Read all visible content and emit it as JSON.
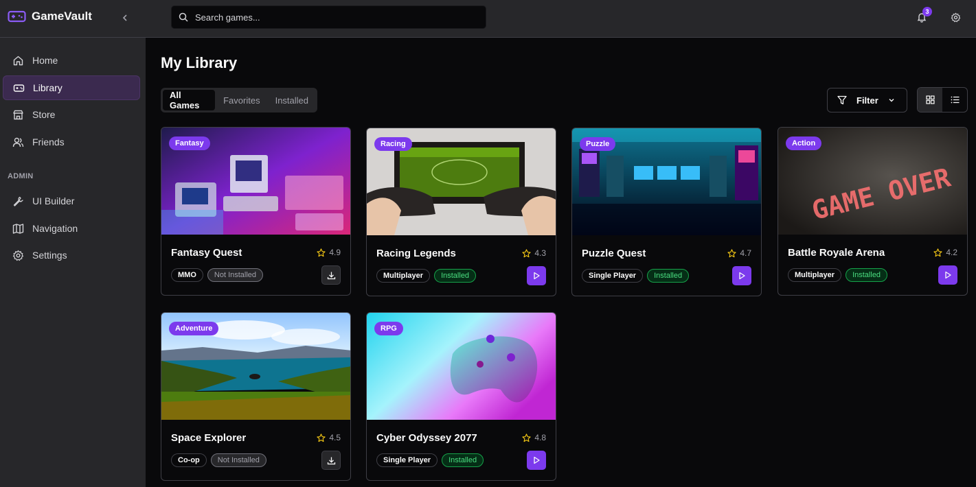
{
  "app": {
    "name": "GameVault",
    "accent": "#7c3aed"
  },
  "search": {
    "placeholder": "Search games..."
  },
  "notifications": {
    "count": "3"
  },
  "sidebar": {
    "items": [
      {
        "label": "Home",
        "icon": "home-icon"
      },
      {
        "label": "Library",
        "icon": "gamepad-icon",
        "active": true
      },
      {
        "label": "Store",
        "icon": "store-icon"
      },
      {
        "label": "Friends",
        "icon": "users-icon"
      }
    ],
    "admin_label": "ADMIN",
    "admin_items": [
      {
        "label": "UI Builder",
        "icon": "wrench-icon"
      },
      {
        "label": "Navigation",
        "icon": "map-icon"
      },
      {
        "label": "Settings",
        "icon": "settings-icon"
      }
    ]
  },
  "main": {
    "title": "My Library",
    "tabs": [
      "All Games",
      "Favorites",
      "Installed"
    ],
    "active_tab": "All Games",
    "filter_label": "Filter",
    "view_mode": "grid"
  },
  "games": [
    {
      "genre": "Fantasy",
      "title": "Fantasy Quest",
      "rating": "4.9",
      "mode": "MMO",
      "status": "Not Installed",
      "action": "download"
    },
    {
      "genre": "Racing",
      "title": "Racing Legends",
      "rating": "4.3",
      "mode": "Multiplayer",
      "status": "Installed",
      "action": "play"
    },
    {
      "genre": "Puzzle",
      "title": "Puzzle Quest",
      "rating": "4.7",
      "mode": "Single Player",
      "status": "Installed",
      "action": "play"
    },
    {
      "genre": "Action",
      "title": "Battle Royale Arena",
      "rating": "4.2",
      "mode": "Multiplayer",
      "status": "Installed",
      "action": "play"
    },
    {
      "genre": "Adventure",
      "title": "Space Explorer",
      "rating": "4.5",
      "mode": "Co-op",
      "status": "Not Installed",
      "action": "download"
    },
    {
      "genre": "RPG",
      "title": "Cyber Odyssey 2077",
      "rating": "4.8",
      "mode": "Single Player",
      "status": "Installed",
      "action": "play"
    }
  ],
  "images": {
    "game_over_text": "GAME OVER"
  }
}
